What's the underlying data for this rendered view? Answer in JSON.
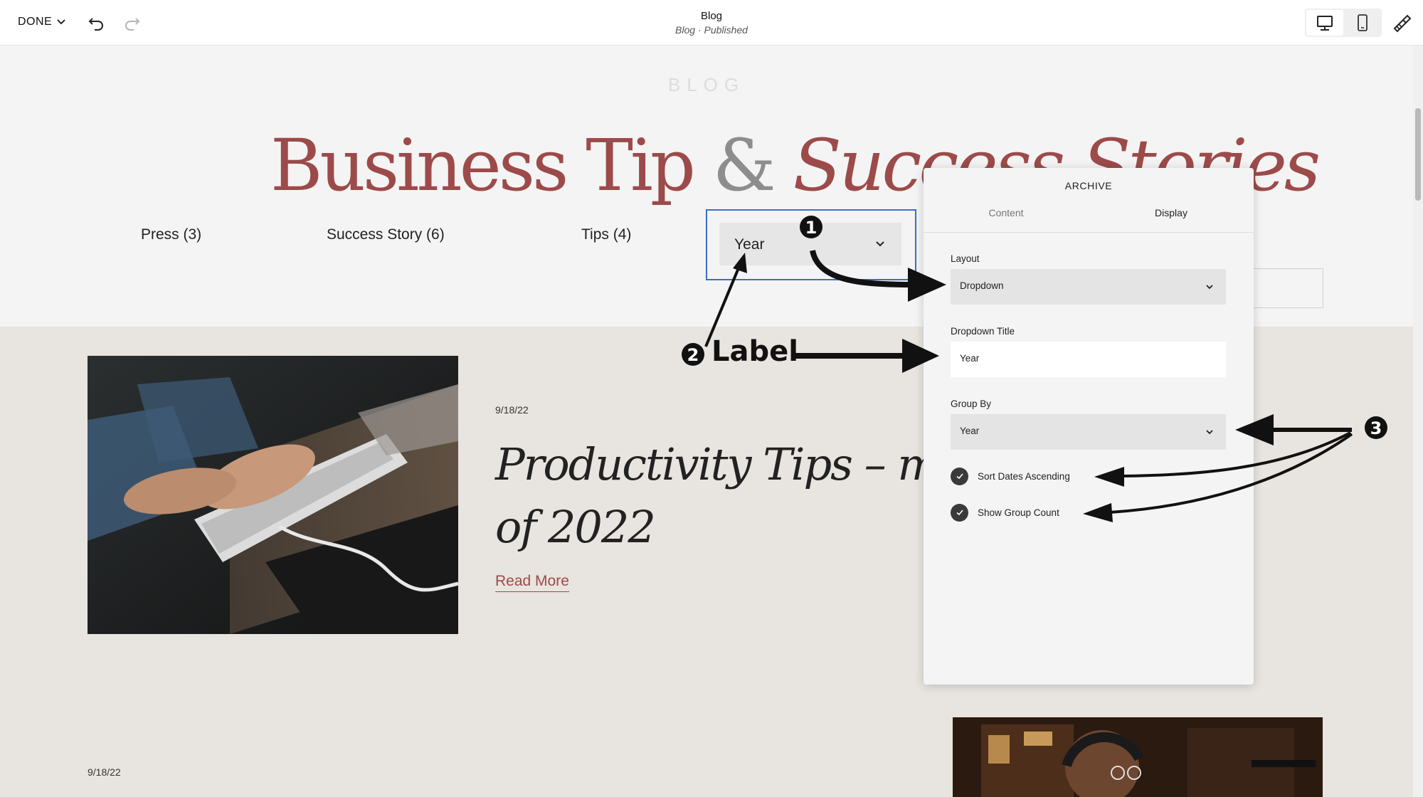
{
  "topbar": {
    "done_label": "DONE",
    "page_title": "Blog",
    "page_subtitle": "Blog · Published",
    "icons": [
      "chevron-down-icon",
      "undo-icon",
      "redo-icon",
      "desktop-icon",
      "mobile-icon",
      "style-brush-icon"
    ]
  },
  "hero": {
    "eyebrow": "BLOG",
    "title_part1": "Business Tip",
    "title_amp": "&",
    "title_part2": "Success Stories",
    "categories": [
      {
        "label": "Press (3)"
      },
      {
        "label": "Success Story (6)"
      },
      {
        "label": "Tips (4)"
      }
    ],
    "dropdown_label": "Year"
  },
  "posts": [
    {
      "date": "9/18/22",
      "title": "Productivity Tips – my f… of 2022",
      "title_line1": "Productivity Tips – my f",
      "title_line2": "of 2022",
      "read_more": "Read More"
    },
    {
      "date": "9/18/22"
    }
  ],
  "panel": {
    "title": "ARCHIVE",
    "tabs": [
      {
        "label": "Content",
        "active": false
      },
      {
        "label": "Display",
        "active": true
      }
    ],
    "layout_label": "Layout",
    "layout_value": "Dropdown",
    "dropdown_title_label": "Dropdown Title",
    "dropdown_title_value": "Year",
    "group_by_label": "Group By",
    "group_by_value": "Year",
    "sort_dates_label": "Sort Dates Ascending",
    "sort_dates_checked": true,
    "show_count_label": "Show Group Count",
    "show_count_checked": true
  },
  "annotations": {
    "marker1": "❶",
    "marker2": "❷",
    "marker3": "❸",
    "label_text": "Label"
  },
  "colors": {
    "accent_maroon": "#9c4b4a",
    "selection_blue": "#3e6dcb",
    "hero_bg": "#f4f4f4",
    "list_bg": "#e8e4df"
  }
}
